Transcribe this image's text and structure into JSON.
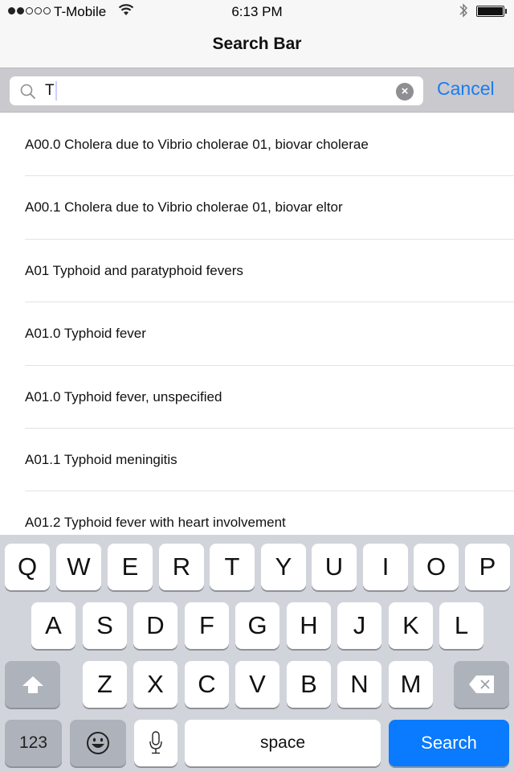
{
  "status_bar": {
    "signal_bars_filled": 2,
    "signal_bars_total": 5,
    "carrier": "T-Mobile",
    "time": "6:13 PM",
    "battery_level": 1.0
  },
  "nav": {
    "title": "Search Bar"
  },
  "search": {
    "value": "T",
    "placeholder": "",
    "cancel_label": "Cancel",
    "icon": "search-icon",
    "clear_icon": "clear-icon"
  },
  "results": [
    {
      "label": "A00.0 Cholera due to Vibrio cholerae 01, biovar cholerae"
    },
    {
      "label": "A00.1 Cholera due to Vibrio cholerae 01, biovar eltor"
    },
    {
      "label": "A01 Typhoid and paratyphoid fevers"
    },
    {
      "label": "A01.0 Typhoid fever"
    },
    {
      "label": "A01.0 Typhoid fever, unspecified"
    },
    {
      "label": "A01.1 Typhoid meningitis"
    },
    {
      "label": "A01.2 Typhoid fever with heart involvement"
    }
  ],
  "keyboard": {
    "row1": [
      "Q",
      "W",
      "E",
      "R",
      "T",
      "Y",
      "U",
      "I",
      "O",
      "P"
    ],
    "row2": [
      "A",
      "S",
      "D",
      "F",
      "G",
      "H",
      "J",
      "K",
      "L"
    ],
    "row3": [
      "Z",
      "X",
      "C",
      "V",
      "B",
      "N",
      "M"
    ],
    "numbers_label": "123",
    "space_label": "space",
    "search_label": "Search",
    "accent_color": "#0a7aff"
  },
  "colors": {
    "link": "#1b7cf2",
    "keyboard_bg": "#d1d5db",
    "searchbar_bg": "#c9c9ce"
  }
}
